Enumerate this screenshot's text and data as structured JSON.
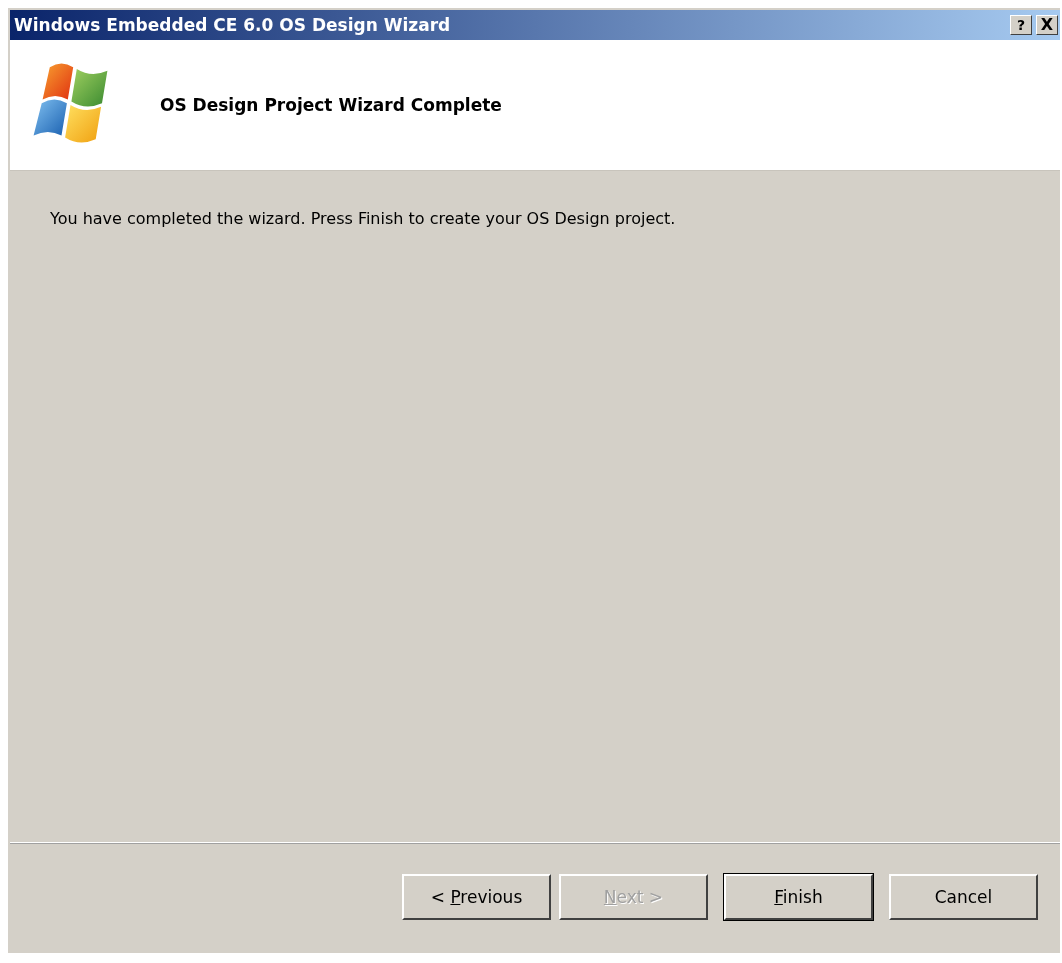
{
  "window": {
    "title": "Windows Embedded CE 6.0 OS Design Wizard",
    "controls": [
      {
        "kind": "help",
        "label": "?"
      },
      {
        "kind": "close",
        "label": "X"
      }
    ]
  },
  "header": {
    "title": "OS Design Project Wizard Complete"
  },
  "body": {
    "message": "You have completed the wizard. Press Finish to create your OS Design project."
  },
  "buttons": [
    {
      "prefix": "< ",
      "access_key": "P",
      "suffix": "revious",
      "disabled": false,
      "default": false
    },
    {
      "access_key": "N",
      "suffix": "ext >",
      "disabled": true,
      "default": false
    },
    {
      "access_key": "F",
      "suffix": "inish",
      "disabled": false,
      "default": true
    },
    {
      "prefix": "Cancel",
      "disabled": false,
      "default": false
    }
  ]
}
